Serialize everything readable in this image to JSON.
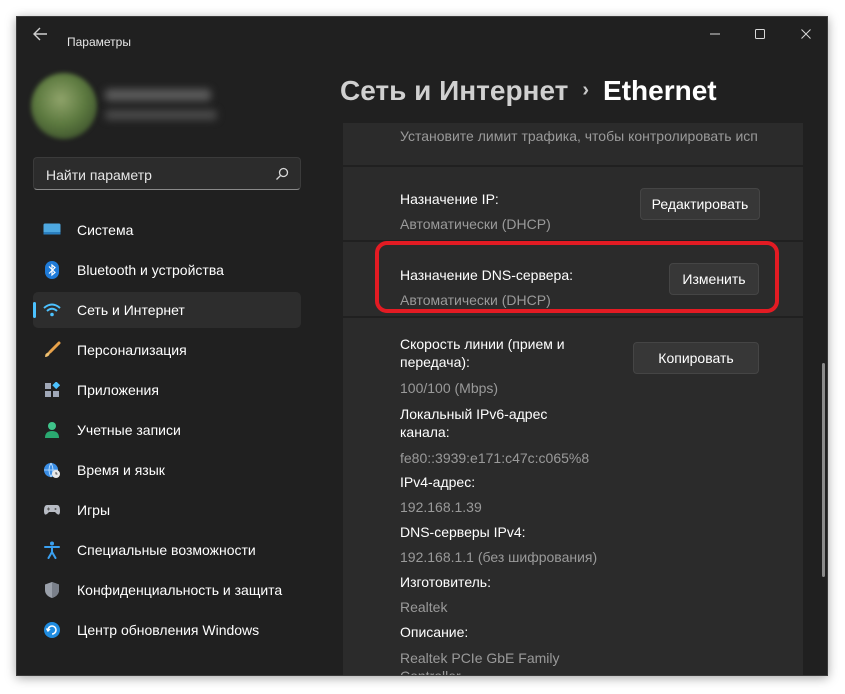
{
  "window": {
    "title": "Параметры",
    "controls": {
      "minimize": "—",
      "maximize": "☐",
      "close": "✕"
    }
  },
  "search": {
    "placeholder": "Найти параметр"
  },
  "sidebar": {
    "items": [
      {
        "label": "Система",
        "icon": "system-display-icon",
        "active": false
      },
      {
        "label": "Bluetooth и устройства",
        "icon": "bluetooth-icon",
        "active": false
      },
      {
        "label": "Сеть и Интернет",
        "icon": "wifi-icon",
        "active": true
      },
      {
        "label": "Персонализация",
        "icon": "brush-icon",
        "active": false
      },
      {
        "label": "Приложения",
        "icon": "apps-icon",
        "active": false
      },
      {
        "label": "Учетные записи",
        "icon": "person-icon",
        "active": false
      },
      {
        "label": "Время и язык",
        "icon": "globe-clock-icon",
        "active": false
      },
      {
        "label": "Игры",
        "icon": "gamepad-icon",
        "active": false
      },
      {
        "label": "Специальные возможности",
        "icon": "accessibility-icon",
        "active": false
      },
      {
        "label": "Конфиденциальность и защита",
        "icon": "shield-icon",
        "active": false
      },
      {
        "label": "Центр обновления Windows",
        "icon": "update-icon",
        "active": false
      }
    ]
  },
  "breadcrumb": {
    "parent": "Сеть и Интернет",
    "separator": "›",
    "current": "Ethernet"
  },
  "content": {
    "traffic_limit_text": "Установите лимит трафика, чтобы контролировать исп",
    "ip_assignment": {
      "label": "Назначение IP:",
      "value": "Автоматически (DHCP)",
      "button": "Редактировать"
    },
    "dns_assignment": {
      "label": "Назначение DNS-сервера:",
      "value": "Автоматически (DHCP)",
      "button": "Изменить"
    },
    "properties": {
      "copy_button": "Копировать",
      "link_speed_label_1": "Скорость линии (прием и",
      "link_speed_label_2": "передача):",
      "link_speed_value": "100/100 (Mbps)",
      "ipv6_label_1": "Локальный IPv6-адрес",
      "ipv6_label_2": "канала:",
      "ipv6_value": "fe80::3939:e171:c47c:c065%8",
      "ipv4_label": "IPv4-адрес:",
      "ipv4_value": "192.168.1.39",
      "dns_servers_label": "DNS-серверы IPv4:",
      "dns_servers_value": "192.168.1.1 (без шифрования)",
      "manufacturer_label": "Изготовитель:",
      "manufacturer_value": "Realtek",
      "description_label": "Описание:",
      "description_value_1": "Realtek PCIe GbE Family",
      "description_value_2": "Controller"
    }
  },
  "colors": {
    "accent": "#4cc2ff",
    "window_bg": "#202020",
    "panel_bg": "#2b2b2b",
    "highlight_border": "#e31b23"
  }
}
